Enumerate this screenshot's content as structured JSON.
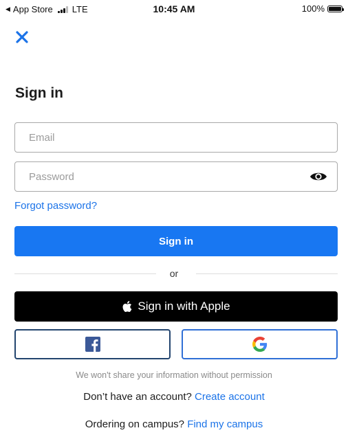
{
  "status_bar": {
    "back_app": "App Store",
    "network": "LTE",
    "time": "10:45 AM",
    "battery": "100%",
    "battery_level": 1.0
  },
  "header": {
    "close_icon": "close-icon",
    "title": "Sign in"
  },
  "form": {
    "email_placeholder": "Email",
    "email_value": "",
    "password_placeholder": "Password",
    "password_value": "",
    "show_password_icon": "eye-icon",
    "forgot_password": "Forgot password?",
    "submit_label": "Sign in"
  },
  "alt": {
    "or_label": "or",
    "apple_label": "Sign in with Apple",
    "apple_icon": "apple-icon",
    "facebook_icon": "facebook-icon",
    "google_icon": "google-icon"
  },
  "footer": {
    "privacy_note": "We won't share your information without permission",
    "no_account_text": "Don’t have an account?",
    "create_account": "Create account",
    "campus_text": "Ordering on campus?",
    "find_campus": "Find my campus"
  },
  "colors": {
    "primary": "#1877f2",
    "link": "#1b73e8",
    "apple_bg": "#000000",
    "facebook": "#3b5998"
  }
}
